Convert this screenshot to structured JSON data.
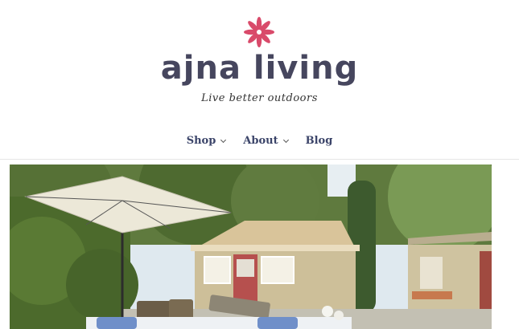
{
  "brand": {
    "name": "ajna living",
    "tagline": "Live better outdoors",
    "accent": "#d94a6a",
    "text_color": "#46465e"
  },
  "nav": {
    "items": [
      {
        "label": "Shop",
        "has_dropdown": true
      },
      {
        "label": "About",
        "has_dropdown": true
      },
      {
        "label": "Blog",
        "has_dropdown": false
      }
    ]
  },
  "hero": {
    "icon": "patio-photo"
  }
}
